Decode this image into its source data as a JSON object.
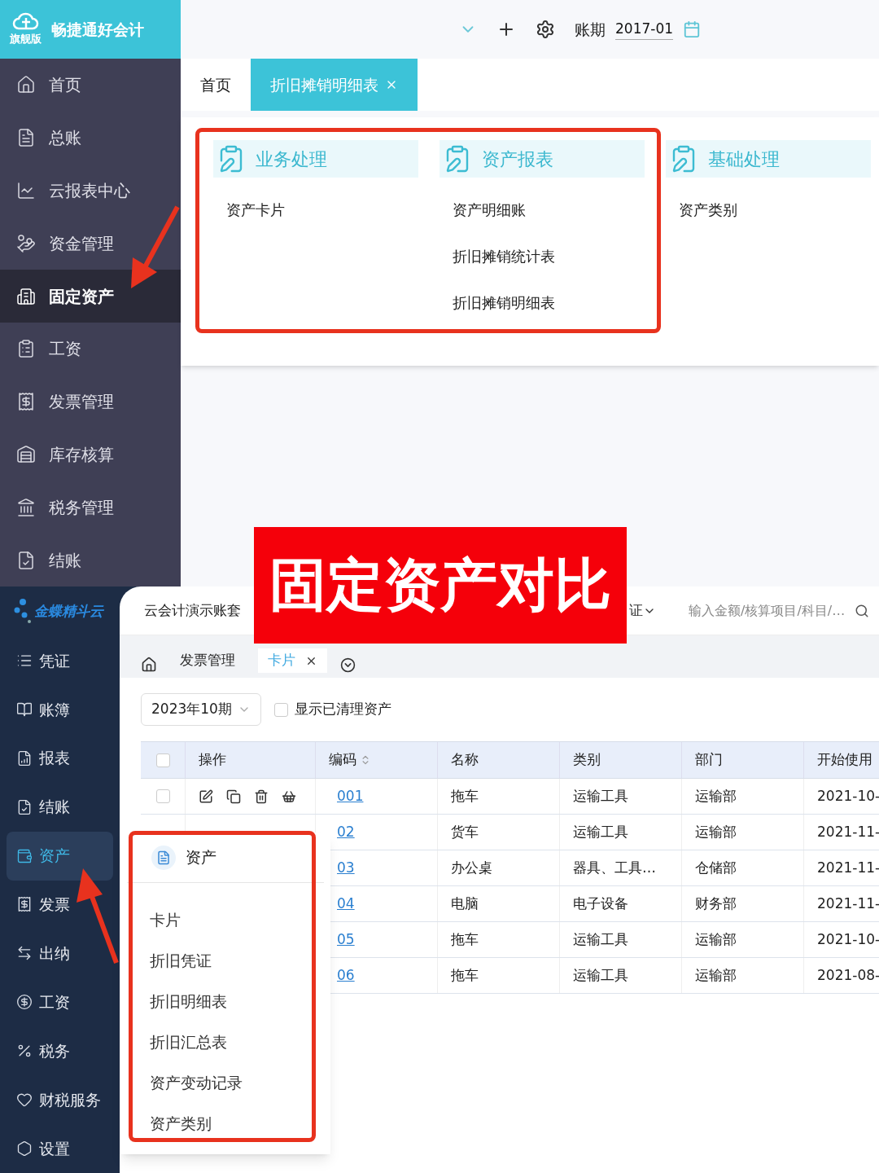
{
  "top_app": {
    "logo": {
      "name": "畅捷通好会计",
      "edition": "旗舰版"
    },
    "sidebar": [
      {
        "label": "首页",
        "selected": false
      },
      {
        "label": "总账",
        "selected": false
      },
      {
        "label": "云报表中心",
        "selected": false
      },
      {
        "label": "资金管理",
        "selected": false
      },
      {
        "label": "固定资产",
        "selected": true
      },
      {
        "label": "工资",
        "selected": false
      },
      {
        "label": "发票管理",
        "selected": false
      },
      {
        "label": "库存核算",
        "selected": false
      },
      {
        "label": "税务管理",
        "selected": false
      },
      {
        "label": "结账",
        "selected": false
      }
    ],
    "toolbar": {
      "period_label": "账期",
      "period": "2017-01"
    },
    "tabs": [
      {
        "label": "首页",
        "selected": false,
        "closable": false
      },
      {
        "label": "折旧摊销明细表",
        "selected": true,
        "closable": true
      }
    ],
    "menu_groups": [
      {
        "title": "业务处理",
        "items": [
          "资产卡片"
        ]
      },
      {
        "title": "资产报表",
        "items": [
          "资产明细账",
          "折旧摊销统计表",
          "折旧摊销明细表"
        ]
      },
      {
        "title": "基础处理",
        "items": [
          "资产类别"
        ]
      }
    ]
  },
  "bottom_app": {
    "brand": "金蝶精斗云",
    "sidebar": [
      {
        "label": "凭证",
        "selected": false
      },
      {
        "label": "账簿",
        "selected": false
      },
      {
        "label": "报表",
        "selected": false
      },
      {
        "label": "结账",
        "selected": false
      },
      {
        "label": "资产",
        "selected": true
      },
      {
        "label": "发票",
        "selected": false
      },
      {
        "label": "出纳",
        "selected": false
      },
      {
        "label": "工资",
        "selected": false
      },
      {
        "label": "税务",
        "selected": false
      },
      {
        "label": "财税服务",
        "selected": false
      },
      {
        "label": "设置",
        "selected": false
      }
    ],
    "account_set": "云会计演示账套",
    "voucher_menu": "证",
    "search": {
      "placeholder": "输入金额/核算项目/科目/…"
    },
    "tabs": [
      {
        "label": "发票管理",
        "selected": false,
        "closable": false
      },
      {
        "label": "卡片",
        "selected": true,
        "closable": true
      }
    ],
    "period_select": "2023年10期",
    "show_cleared": {
      "label": "显示已清理资产",
      "checked": false
    },
    "table": {
      "select_all": {
        "checked": false
      },
      "columns": [
        "操作",
        "编码",
        "名称",
        "类别",
        "部门",
        "开始使用"
      ],
      "rows": [
        {
          "actions": true,
          "checked": false,
          "code": "001",
          "name": "拖车",
          "category": "运输工具",
          "department": "运输部",
          "start_date": "2021-10-"
        },
        {
          "code": "02",
          "name": "货车",
          "category": "运输工具",
          "department": "运输部",
          "start_date": "2021-11-"
        },
        {
          "code": "03",
          "name": "办公桌",
          "category": "器具、工具…",
          "department": "仓储部",
          "start_date": "2021-11-"
        },
        {
          "code": "04",
          "name": "电脑",
          "category": "电子设备",
          "department": "财务部",
          "start_date": "2021-11-"
        },
        {
          "code": "05",
          "name": "拖车",
          "category": "运输工具",
          "department": "运输部",
          "start_date": "2021-10-"
        },
        {
          "code": "06",
          "name": "拖车",
          "category": "运输工具",
          "department": "运输部",
          "start_date": "2021-08-"
        }
      ]
    },
    "flyout": {
      "title": "资产",
      "items": [
        "卡片",
        "折旧凭证",
        "折旧明细表",
        "折旧汇总表",
        "资产变动记录",
        "资产类别"
      ]
    }
  },
  "banner": "固定资产对比"
}
